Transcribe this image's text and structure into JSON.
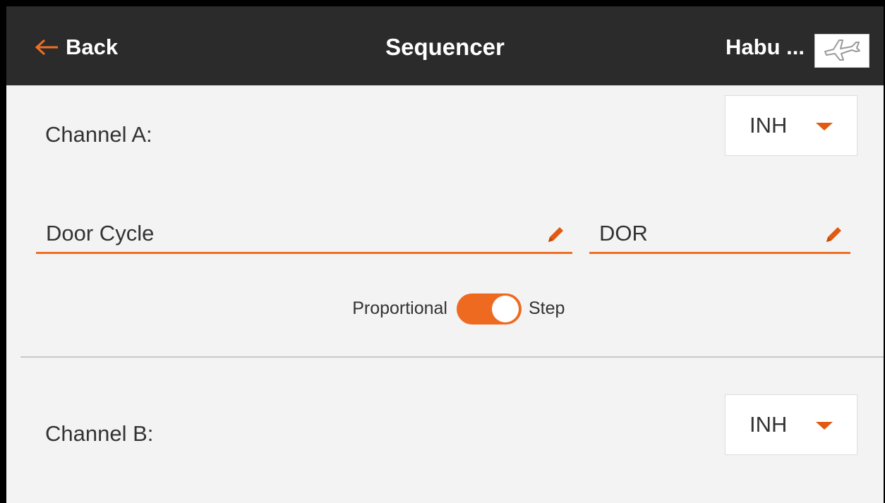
{
  "header": {
    "back_label": "Back",
    "title": "Sequencer",
    "model_name": "Habu ...",
    "back_icon": "arrow-left-icon",
    "model_icon": "airplane-icon"
  },
  "channel_a": {
    "label": "Channel A:",
    "switch_value": "INH",
    "name_value": "Door Cycle",
    "short_name_value": "DOR",
    "mode": {
      "left_label": "Proportional",
      "right_label": "Step",
      "selected": "Step"
    }
  },
  "channel_b": {
    "label": "Channel B:",
    "switch_value": "INH"
  },
  "colors": {
    "accent": "#ee7024",
    "header_bg": "#2b2b2b",
    "background": "#f3f3f3"
  }
}
